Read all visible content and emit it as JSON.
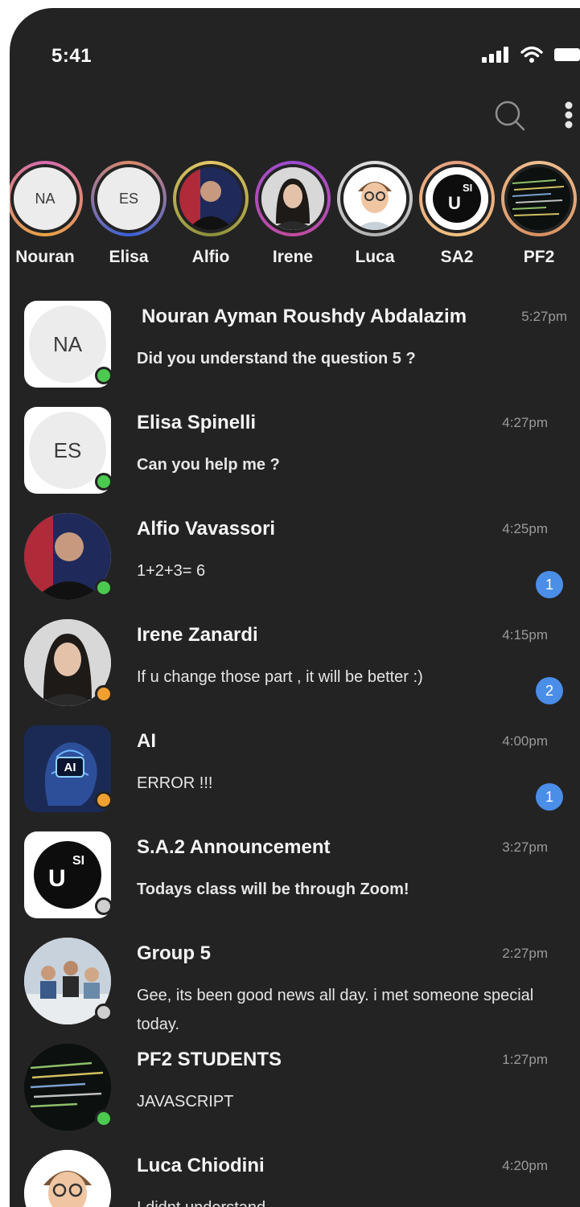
{
  "status_bar": {
    "time": "5:41"
  },
  "colors": {
    "background": "#232323",
    "online": "#4cc94f",
    "away": "#f0a030",
    "offline": "#cfcfcf",
    "unread_badge": "#4a8ee8"
  },
  "icons": {
    "header": [
      "search-icon",
      "more-vertical-icon"
    ],
    "status": [
      "signal-icon",
      "wifi-icon",
      "battery-icon"
    ]
  },
  "stories": [
    {
      "name": "Nouran",
      "initials": "NA"
    },
    {
      "name": "Elisa",
      "initials": "ES"
    },
    {
      "name": "Alfio"
    },
    {
      "name": "Irene"
    },
    {
      "name": "Luca"
    },
    {
      "name": "SA2"
    },
    {
      "name": "PF2"
    }
  ],
  "chats": [
    {
      "name": "Nouran Ayman Roushdy Abdalazim",
      "time": "5:27pm",
      "message": "Did you understand the question 5 ?",
      "initials": "NA",
      "presence": "online"
    },
    {
      "name": "Elisa Spinelli",
      "time": "4:27pm",
      "message": "Can you help me ?",
      "initials": "ES",
      "presence": "online"
    },
    {
      "name": "Alfio Vavassori",
      "time": "4:25pm",
      "message": "1+2+3= 6",
      "presence": "online",
      "unread": "1"
    },
    {
      "name": "Irene Zanardi",
      "time": "4:15pm",
      "message": "If u change those part , it will be better :)",
      "presence": "away",
      "unread": "2"
    },
    {
      "name": "AI",
      "time": "4:00pm",
      "message": "ERROR !!!",
      "presence": "away",
      "unread": "1",
      "badge_text": "AI"
    },
    {
      "name": "S.A.2 Announcement",
      "time": "3:27pm",
      "message": "Todays class will be through Zoom!",
      "presence": "offline",
      "logo_text": "U",
      "logo_sub": "SI"
    },
    {
      "name": "Group 5",
      "time": "2:27pm",
      "message": "Gee, its been good news all day. i met someone special today.",
      "presence": "offline"
    },
    {
      "name": "PF2 STUDENTS",
      "time": "1:27pm",
      "message": "JAVASCRIPT",
      "presence": "online"
    },
    {
      "name": "Luca Chiodini",
      "time": "4:20pm",
      "message": "I didnt understand"
    }
  ]
}
